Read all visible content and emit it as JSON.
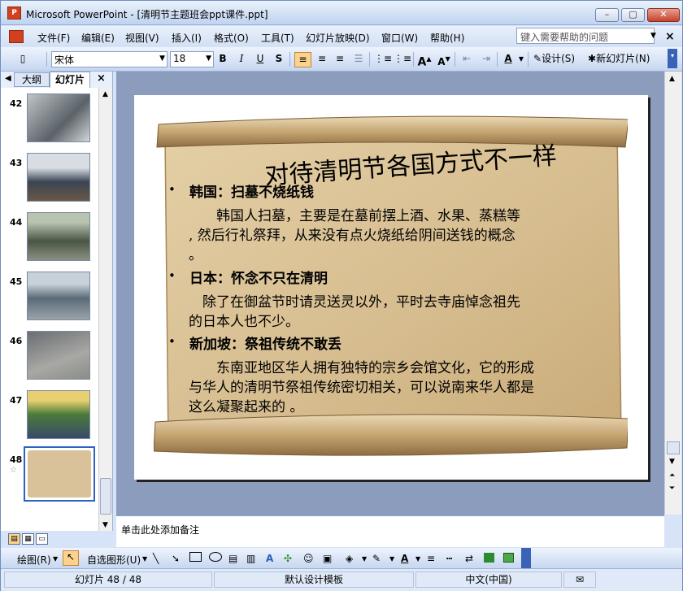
{
  "titlebar": {
    "title": "Microsoft PowerPoint - [清明节主题班会ppt课件.ppt]",
    "app_icon": "P",
    "minimize": "–",
    "maximize": "▢",
    "close": "✕"
  },
  "menubar": {
    "items": [
      "文件(F)",
      "编辑(E)",
      "视图(V)",
      "插入(I)",
      "格式(O)",
      "工具(T)",
      "幻灯片放映(D)",
      "窗口(W)",
      "帮助(H)"
    ],
    "help_placeholder": "键入需要帮助的问题",
    "doc_close": "×"
  },
  "toolbar": {
    "new": "▯",
    "font_name": "宋体",
    "font_size": "18",
    "bold": "B",
    "italic": "I",
    "underline": "U",
    "shadow": "S",
    "design_label": "设计(S)",
    "new_slide_label": "新幻灯片(N)",
    "font_color": "A"
  },
  "leftpane": {
    "tabs": [
      "大纲",
      "幻灯片"
    ],
    "close": "×",
    "slide_numbers": [
      "42",
      "43",
      "44",
      "45",
      "46",
      "47",
      "48"
    ],
    "star": "☆"
  },
  "slide": {
    "title": "对待清明节各国方式不一样",
    "sections": [
      {
        "heading": "韩国：扫墓不烧纸钱",
        "lines": [
          "　　韩国人扫墓，主要是在墓前摆上酒、水果、蒸糕等",
          ", 然后行礼祭拜，从来没有点火烧纸给阴间送钱的概念",
          "。"
        ]
      },
      {
        "heading": "日本：怀念不只在清明",
        "lines": [
          "　除了在御盆节时请灵送灵以外，平时去寺庙悼念祖先",
          "的日本人也不少。"
        ]
      },
      {
        "heading": "新加坡：祭祖传统不敢丢",
        "lines": [
          "　　东南亚地区华人拥有独特的宗乡会馆文化，它的形成",
          "与华人的清明节祭祖传统密切相关，可以说南来华人都是",
          "这么凝聚起来的 。"
        ]
      }
    ],
    "bullet": "•"
  },
  "notes": {
    "placeholder": "单击此处添加备注"
  },
  "drawbar": {
    "draw": "绘图(R)",
    "autoshape": "自选图形(U)"
  },
  "status": {
    "slide_pos": "幻灯片 48 / 48",
    "template": "默认设计模板",
    "language": "中文(中国)"
  },
  "colors": {
    "accent": "#3060c0",
    "parchment": "#d9c29a",
    "parchment_edge": "#b8996a"
  }
}
